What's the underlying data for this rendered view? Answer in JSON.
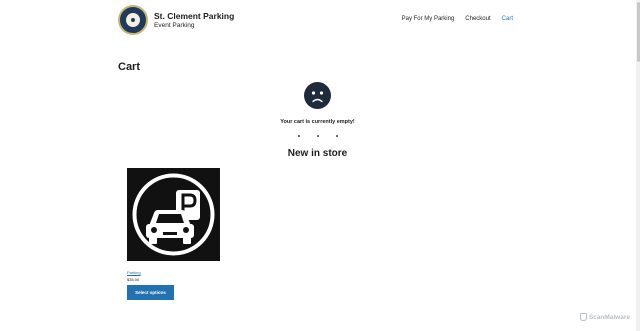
{
  "site": {
    "title": "St. Clement Parking",
    "tagline": "Event Parking",
    "logo_icon": "parish-seal-logo"
  },
  "nav": {
    "items": [
      {
        "label": "Pay For My Parking",
        "active": false
      },
      {
        "label": "Checkout",
        "active": false
      },
      {
        "label": "Cart",
        "active": true
      }
    ]
  },
  "page": {
    "title": "Cart",
    "empty_icon": "sad-face-icon",
    "empty_message": "Your cart is currently empty!",
    "new_heading": "New in store"
  },
  "products": [
    {
      "name": "Parking",
      "price": "$35.00",
      "image_icon": "car-parking-icon",
      "button_label": "Select options"
    }
  ],
  "watermark": "ScanMalware",
  "colors": {
    "accent": "#2271b1",
    "icon_dark": "#1e2b3c"
  }
}
